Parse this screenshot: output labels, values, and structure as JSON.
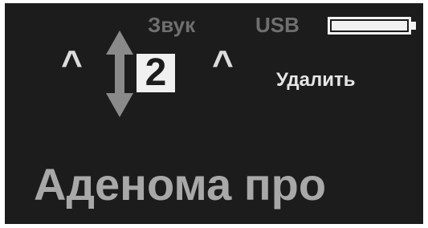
{
  "status_bar": {
    "sound_label": "Звук",
    "usb_label": "USB",
    "battery_icon": "battery-icon",
    "battery_level": 1.0
  },
  "editor": {
    "left_caret": "^",
    "right_caret": "^",
    "updown_icon": "up-down-arrow-icon",
    "current_digit": "2",
    "delete_label": "Удалить"
  },
  "message": {
    "text": "Аденома про"
  },
  "colors": {
    "screen_background": "#1c1c1c",
    "dim_text": "#6f6f6f",
    "bright_text": "#e6e6e6",
    "message_text": "#a8a8a8"
  }
}
